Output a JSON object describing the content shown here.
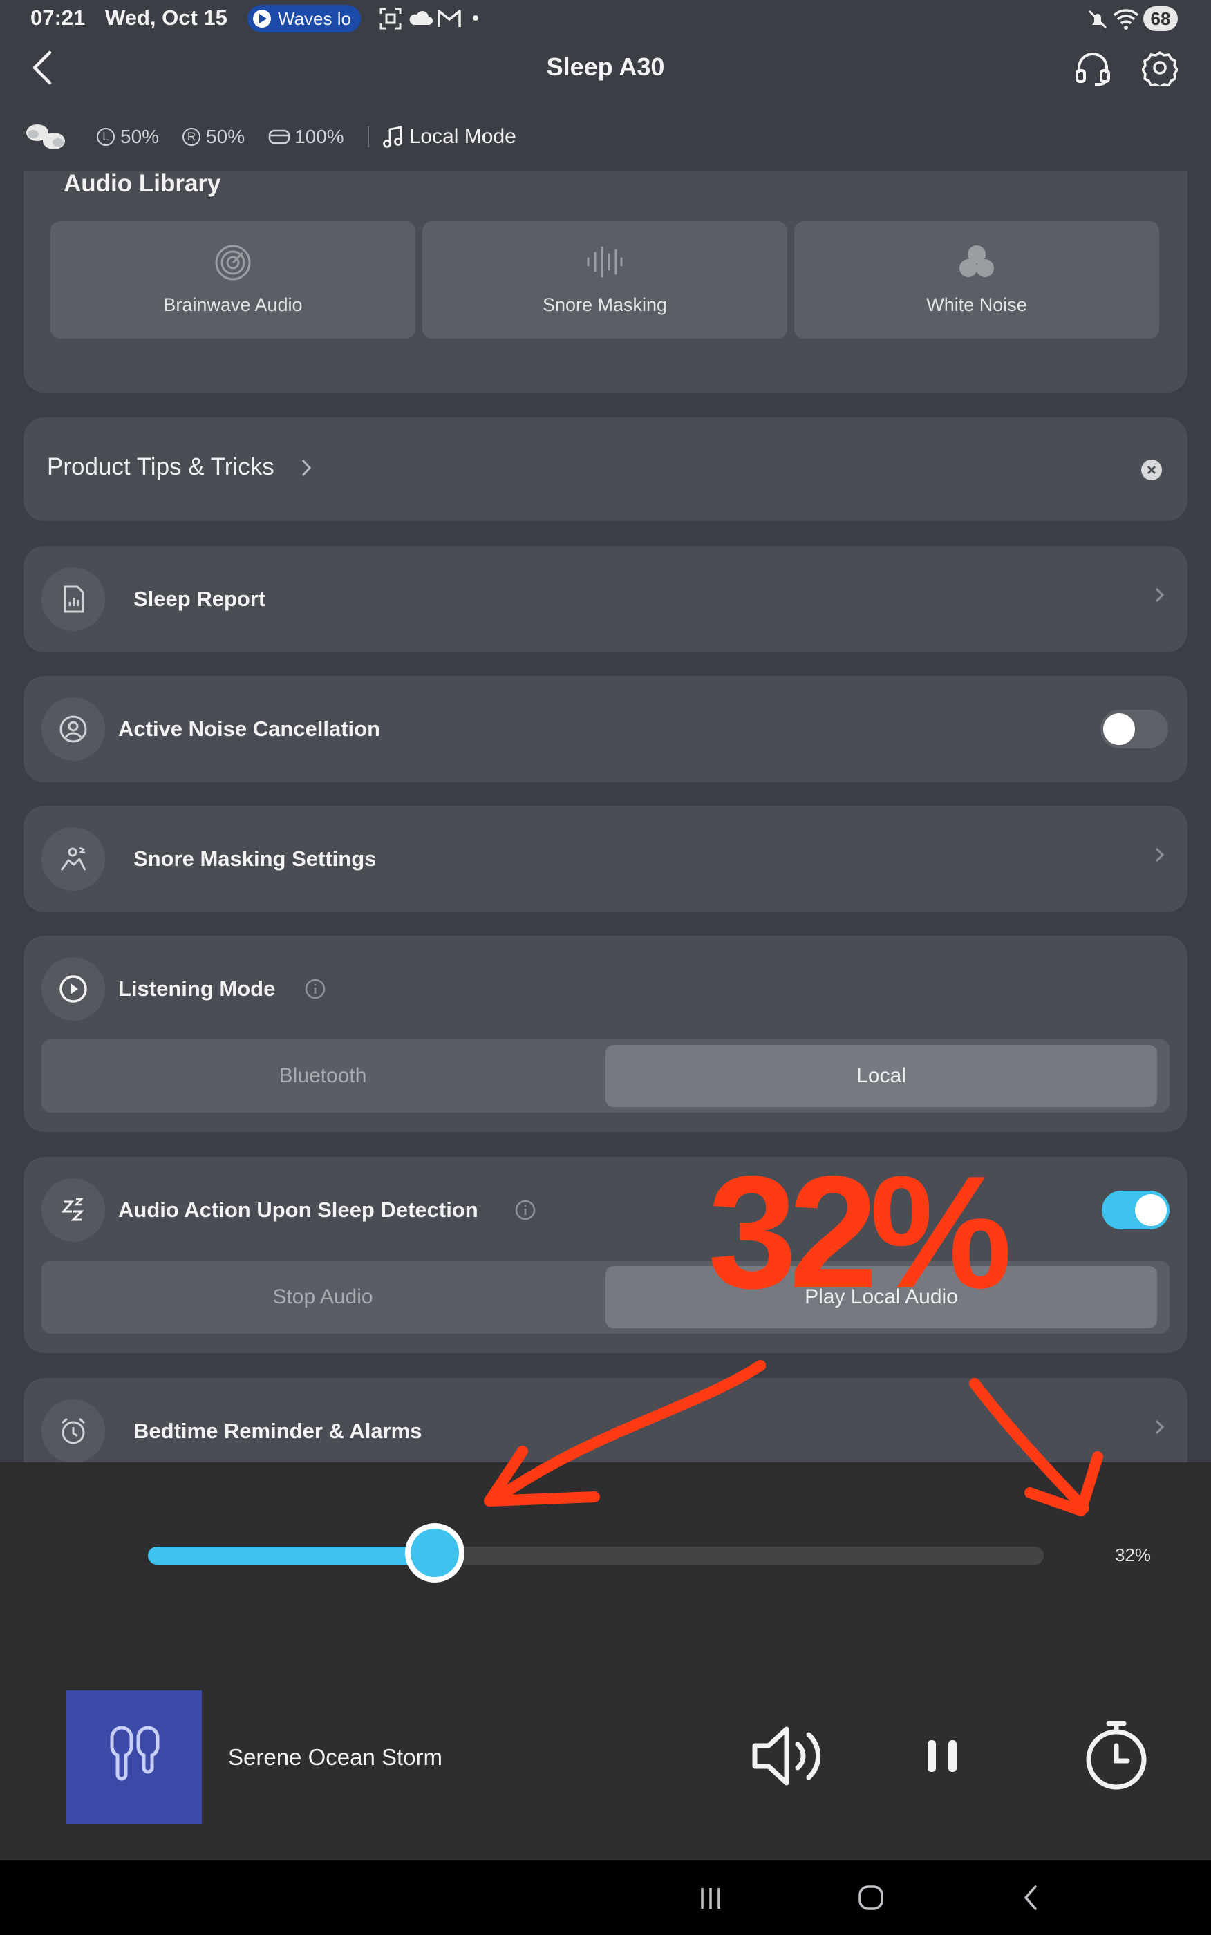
{
  "status": {
    "time": "07:21",
    "date": "Wed, Oct 15",
    "waves_chip": "Waves lo",
    "battery": "68"
  },
  "header": {
    "title": "Sleep A30",
    "left_bud": "50%",
    "right_bud": "50%",
    "case": "100%",
    "mode": "Local Mode"
  },
  "library": {
    "title": "Audio Library",
    "items": [
      {
        "label": "Brainwave Audio",
        "icon": "brainwave-icon"
      },
      {
        "label": "Snore Masking",
        "icon": "waveform-icon"
      },
      {
        "label": "White Noise",
        "icon": "bubbles-icon"
      }
    ]
  },
  "tips": {
    "label": "Product Tips & Tricks"
  },
  "rows": {
    "sleep_report": "Sleep Report",
    "anc": "Active Noise Cancellation",
    "snore_settings": "Snore Masking Settings",
    "listening_mode": "Listening Mode",
    "sleep_detection": "Audio Action Upon Sleep Detection",
    "bedtime": "Bedtime Reminder & Alarms"
  },
  "listening_mode": {
    "options": [
      "Bluetooth",
      "Local"
    ],
    "selected": "Local"
  },
  "sleep_detection": {
    "options": [
      "Stop Audio",
      "Play Local Audio"
    ],
    "selected": "Play Local Audio",
    "enabled": true
  },
  "anc_enabled": false,
  "annotation": {
    "text": "32%",
    "color": "#ff3b14"
  },
  "player": {
    "volume_label": "32%",
    "volume_fraction": 0.32,
    "track": "Serene Ocean Storm"
  },
  "colors": {
    "accent": "#3fc3ee",
    "card": "#4a4d54",
    "background": "#3b3e45"
  }
}
